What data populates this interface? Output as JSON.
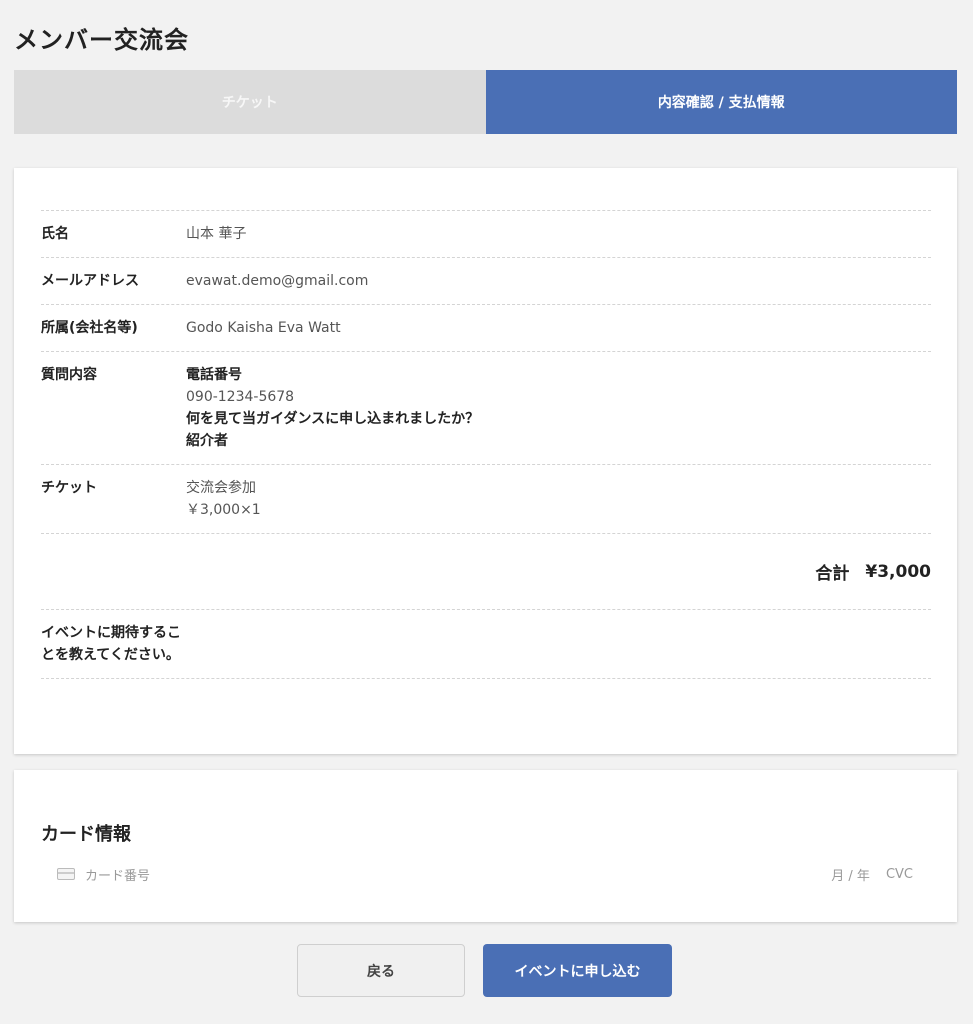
{
  "page": {
    "title": "メンバー交流会"
  },
  "steps": [
    {
      "label": "チケット",
      "active": false
    },
    {
      "label": "内容確認 / 支払情報",
      "active": true
    }
  ],
  "summary": {
    "rows": {
      "name": {
        "label": "氏名",
        "value": "山本 華子"
      },
      "email": {
        "label": "メールアドレス",
        "value": "evawat.demo@gmail.com"
      },
      "company": {
        "label": "所属(会社名等)",
        "value": "Godo Kaisha Eva Watt"
      },
      "questions": {
        "label": "質問内容",
        "q1": "電話番号",
        "a1": "090-1234-5678",
        "q2": "何を見て当ガイダンスに申し込まれましたか？",
        "a2": "紹介者"
      },
      "ticket": {
        "label": "チケット",
        "name": "交流会参加",
        "price": "￥3,000×1"
      }
    },
    "total": {
      "label": "合計",
      "value": "¥3,000"
    },
    "expectations": {
      "label": "イベントに期待することを教えてください。",
      "value": ""
    }
  },
  "payment": {
    "title": "カード情報",
    "card_number_placeholder": "カード番号",
    "expiry_placeholder": "月 / 年",
    "cvc_placeholder": "CVC",
    "icon": "credit-card-icon"
  },
  "buttons": {
    "back": "戻る",
    "submit": "イベントに申し込む"
  },
  "colors": {
    "accent": "#4a6fb5",
    "inactive_step": "#dcdcdc",
    "background": "#f2f2f2"
  }
}
